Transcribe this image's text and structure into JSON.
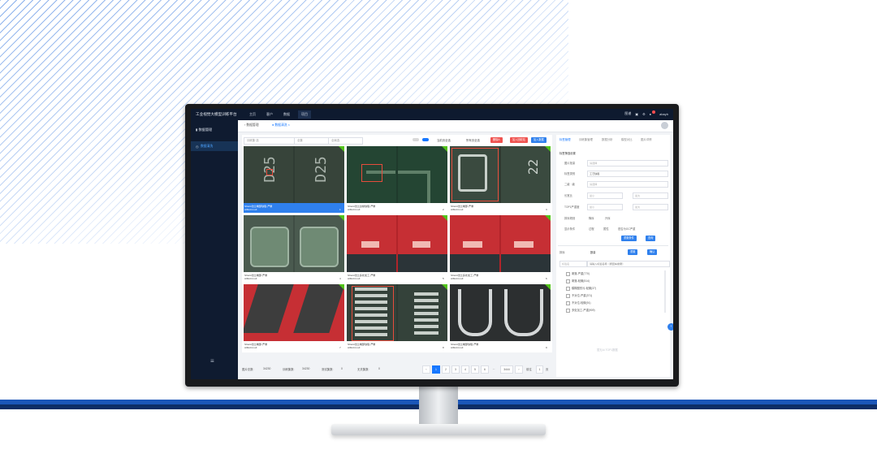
{
  "app": {
    "title": "工业视觉大模型训练平台"
  },
  "topnav": {
    "items": [
      "主页",
      "客户",
      "数据",
      "项目"
    ],
    "right": [
      "图谱",
      "▣",
      "⚙",
      "●",
      "abayh"
    ]
  },
  "sidebar": {
    "header": "数据管理",
    "item": "数据清洗"
  },
  "tabs": {
    "items": [
      "数据管理",
      "数据清洗"
    ]
  },
  "filters": {
    "select1": "训练集·选",
    "select2": "全集",
    "select3": "全局选",
    "text_current": "当前页全选",
    "text_all": "所有页全选",
    "btn_delete": "删除A",
    "btn_mark": "加入回收站",
    "btn_export": "加入数据"
  },
  "cards": [
    {
      "title": "Shield法兰端部缺陷-严重",
      "sub": "AI8mbl.null",
      "num": "1",
      "selected": true
    },
    {
      "title": "Shield法兰边缘缺陷-严重",
      "sub": "AI8mbl.null",
      "num": "2",
      "selected": false
    },
    {
      "title": "Shield法兰端部-严重",
      "sub": "AI8mbl.null",
      "num": "3",
      "selected": false
    },
    {
      "title": "Shield法兰端部-严重",
      "sub": "AI8mbl.null",
      "num": "4",
      "selected": false
    },
    {
      "title": "Shield法兰多处加工-严重",
      "sub": "AI8mbl.null",
      "num": "5",
      "selected": false
    },
    {
      "title": "Shield法兰多处加工-严重",
      "sub": "AI8mbl.null",
      "num": "6",
      "selected": false
    },
    {
      "title": "Shield法兰端部-严重",
      "sub": "AI8mbl.null",
      "num": "7",
      "selected": false
    },
    {
      "title": "Shield法兰端部缺陷-严重",
      "sub": "AI8mbl.null",
      "num": "8",
      "selected": false
    },
    {
      "title": "Shield法兰端部缺陷-严重",
      "sub": "AI8mbl.null",
      "num": "9",
      "selected": false
    }
  ],
  "footer": {
    "total_label": "图片总数:",
    "total": "34230",
    "train_label": "训练集数:",
    "train": "34230",
    "test_label": "测试集数:",
    "test": "0",
    "none_label": "无关集数:",
    "none": "0",
    "pages": [
      "1",
      "2",
      "3",
      "4",
      "5",
      "6",
      "...",
      "3444"
    ],
    "goto_label": "前往",
    "goto_val": "1",
    "page_unit": "页"
  },
  "rpanel": {
    "tabs": [
      "标签管理",
      "训练集管理",
      "数据分析",
      "模型对比",
      "图片详情"
    ],
    "section_title": "标签筛选设置",
    "rows": [
      {
        "label": "图片批量",
        "value": "请选择"
      },
      {
        "label": "标签类别",
        "value": "工艺缺陷"
      },
      {
        "label": "二级 · 级",
        "value": "请选择"
      }
    ],
    "range_rows": [
      {
        "label": "长宽比",
        "a": "最小",
        "b": "最大"
      },
      {
        "label": "TOP1严重度",
        "a": "最小",
        "b": "最大"
      }
    ],
    "order_label": "排序规则",
    "order_opts": [
      "降序",
      "升序"
    ],
    "display_label": "显示条件",
    "display_opts": [
      "过程",
      "属性",
      "是否为GC严重"
    ],
    "btn_reset": "重置条件",
    "btn_search": "查询",
    "sort_label": "排序",
    "sort_sel": "数量",
    "btn_reset2": "重置",
    "btn_apply": "确认",
    "search_sel": "标签名",
    "search_ph": "请输入标签名称（按回车搜索）",
    "list": [
      "剥落-严重(770)",
      "剥落-轻微(514)",
      "模糊图形污-轻微(37)",
      "不对位-严重(371)",
      "不对位-轻微(91)",
      "多处加工-严重(909)"
    ],
    "empty_text": "暂无AI TOP1数据"
  }
}
